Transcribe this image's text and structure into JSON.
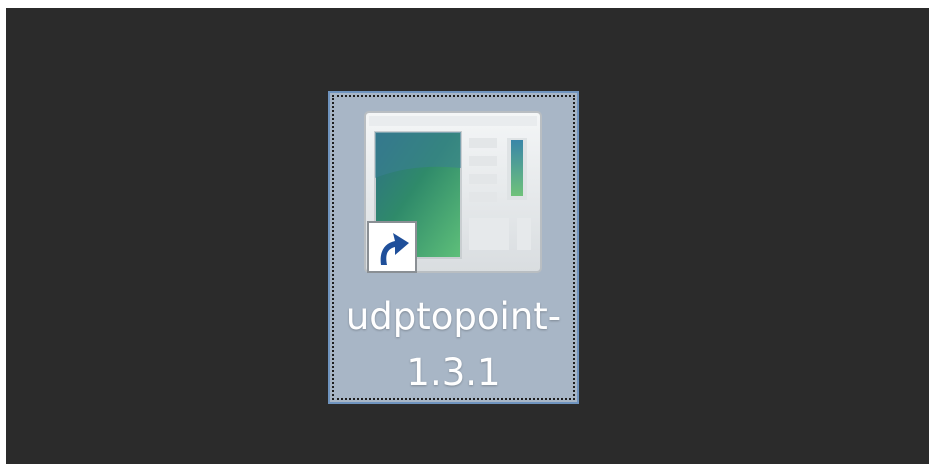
{
  "desktop": {
    "background_color": "#2b2b2b",
    "selected_icon": {
      "label_line1": "udptopoint-",
      "label_line2": "1.3.1",
      "icon": "application-window-icon",
      "overlay": "shortcut-arrow-icon",
      "selected": true,
      "selection_color": "#a8b6c6"
    }
  }
}
